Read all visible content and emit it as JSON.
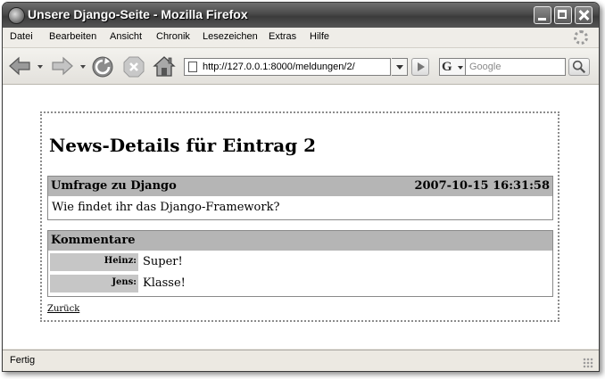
{
  "window": {
    "title": "Unsere Django-Seite - Mozilla Firefox"
  },
  "menu": {
    "items": [
      "Datei",
      "Bearbeiten",
      "Ansicht",
      "Chronik",
      "Lesezeichen",
      "Extras",
      "Hilfe"
    ]
  },
  "toolbar": {
    "url": "http://127.0.0.1:8000/meldungen/2/",
    "search_engine": "G",
    "search_placeholder": "Google"
  },
  "page": {
    "title": "News-Details für Eintrag 2",
    "news": {
      "title": "Umfrage zu Django",
      "date": "2007-10-15 16:31:58",
      "text": "Wie findet ihr das Django-Framework?"
    },
    "comments": {
      "heading": "Kommentare",
      "items": [
        {
          "author": "Heinz:",
          "text": "Super!"
        },
        {
          "author": "Jens:",
          "text": "Klasse!"
        }
      ]
    },
    "back_link": "Zurück"
  },
  "status": {
    "text": "Fertig"
  },
  "colors": {
    "header_gray": "#b5b5b5",
    "author_gray": "#c6c6c6",
    "frame": "#8c8c8c"
  },
  "icons": [
    "firefox-logo-icon",
    "back-arrow-icon",
    "forward-arrow-icon",
    "reload-icon",
    "stop-icon",
    "home-icon",
    "page-icon",
    "go-icon",
    "search-icon",
    "throbber-icon"
  ]
}
